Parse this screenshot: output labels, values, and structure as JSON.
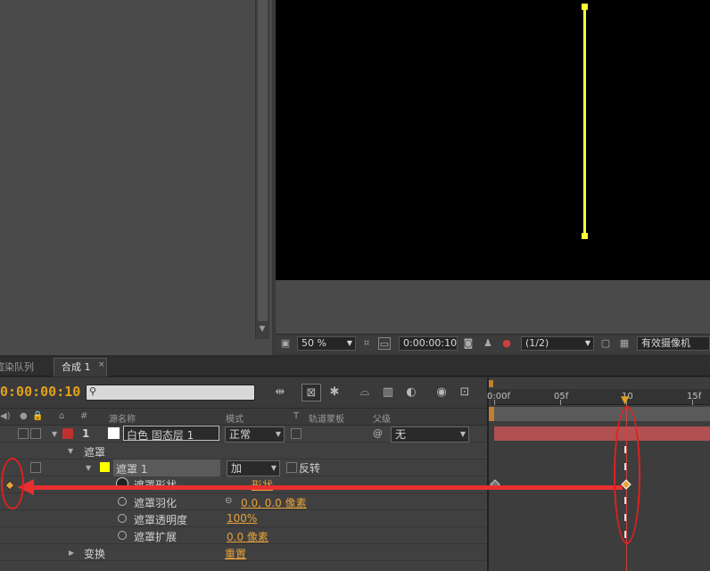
{
  "viewer": {
    "zoom": "50 %",
    "timecode": "0:00:00:10",
    "resolution": "(1/2)",
    "camera": "有效摄像机"
  },
  "tabs": {
    "render_queue": "渲染队列",
    "comp": "合成 1",
    "close": "×"
  },
  "timeline": {
    "current_time": "0:00:00:10",
    "search_placeholder": "",
    "columns": {
      "num": "#",
      "source_name": "源名称",
      "mode": "模式",
      "t": "T",
      "trkmat": "轨道蒙板",
      "parent": "父级"
    },
    "layer": {
      "index": "1",
      "name": "白色 固态层 1",
      "mode": "正常",
      "parent": "无"
    },
    "masks_group": "遮罩",
    "mask": {
      "name": "遮罩 1",
      "mode": "加",
      "invert_label": "反转"
    },
    "properties": [
      {
        "name": "遮罩形状",
        "value": "形状"
      },
      {
        "name": "遮罩羽化",
        "value": "0.0, 0.0 像素"
      },
      {
        "name": "遮罩透明度",
        "value": "100%"
      },
      {
        "name": "遮罩扩展",
        "value": "0.0 像素"
      }
    ],
    "transform": {
      "name": "变换",
      "value": "重置"
    },
    "ruler": [
      "0:00f",
      "05f",
      "10",
      "15f"
    ]
  },
  "colors": {
    "accent": "#e8a23a",
    "mask_path": "#ffff33",
    "layer_bar": "#b05050",
    "annotation": "#e02020"
  }
}
